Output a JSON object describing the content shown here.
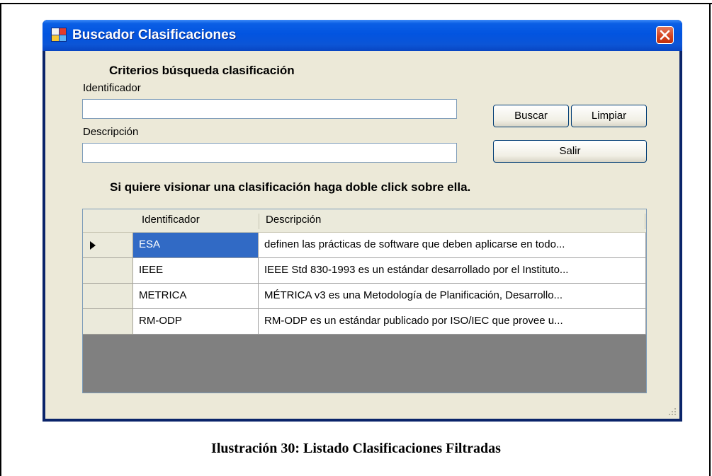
{
  "window": {
    "title": "Buscador Clasificaciones"
  },
  "form": {
    "section_title": "Criterios búsqueda clasificación",
    "identificador_label": "Identificador",
    "identificador_value": "",
    "descripcion_label": "Descripción",
    "descripcion_value": "",
    "buscar_label": "Buscar",
    "limpiar_label": "Limpiar",
    "salir_label": "Salir",
    "instruction": "Si quiere visionar una clasificación haga doble click sobre ella."
  },
  "table": {
    "columns": [
      "Identificador",
      "Descripción"
    ],
    "rows": [
      {
        "id": "ESA",
        "desc": "definen las prácticas de software que deben aplicarse en todo..."
      },
      {
        "id": "IEEE",
        "desc": "IEEE Std 830-1993 es un estándar desarrollado por el Instituto..."
      },
      {
        "id": "METRICA",
        "desc": "MÉTRICA v3 es una Metodología de Planificación, Desarrollo..."
      },
      {
        "id": "RM-ODP",
        "desc": "RM-ODP es un estándar publicado por ISO/IEC que provee u..."
      }
    ],
    "selected_row": 0
  },
  "caption": "Ilustración 30: Listado Clasificaciones Filtradas",
  "colors": {
    "titlebar": "#0254e0",
    "client_bg": "#ece9d8",
    "selection": "#316ac5",
    "grid_empty": "#808080",
    "close_button": "#d3411d"
  },
  "icons": [
    "app-icon",
    "close-icon",
    "row-pointer-icon",
    "resize-grip-icon"
  ]
}
